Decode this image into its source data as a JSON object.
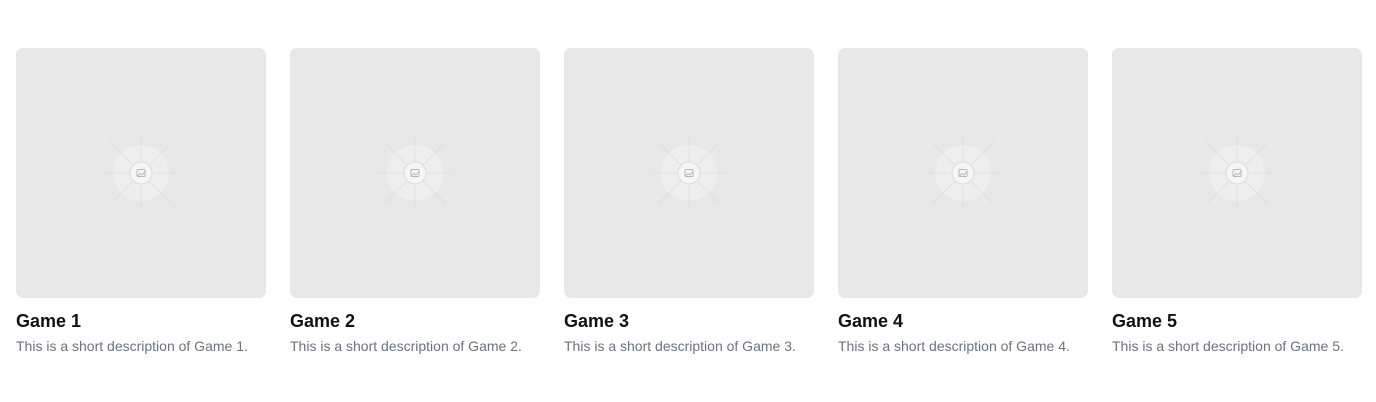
{
  "games": [
    {
      "title": "Game 1",
      "description": "This is a short description of Game 1.",
      "icon": "image-placeholder-icon"
    },
    {
      "title": "Game 2",
      "description": "This is a short description of Game 2.",
      "icon": "image-placeholder-icon"
    },
    {
      "title": "Game 3",
      "description": "This is a short description of Game 3.",
      "icon": "image-placeholder-icon"
    },
    {
      "title": "Game 4",
      "description": "This is a short description of Game 4.",
      "icon": "image-placeholder-icon"
    },
    {
      "title": "Game 5",
      "description": "This is a short description of Game 5.",
      "icon": "image-placeholder-icon"
    }
  ],
  "colors": {
    "thumbnail_bg": "#e8e8e8",
    "title": "#111111",
    "description": "#6b7280"
  }
}
